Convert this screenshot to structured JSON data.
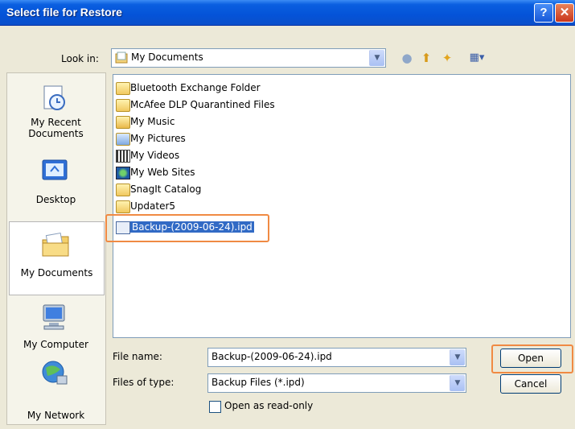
{
  "window": {
    "title": "Select file for Restore"
  },
  "toolbar": {
    "look_in_label": "Look in:",
    "look_in_value": "My Documents",
    "icons": [
      "back-icon",
      "up-folder-icon",
      "new-folder-icon",
      "views-menu-icon"
    ]
  },
  "places": [
    {
      "label": "My Recent Documents",
      "icon": "recent-documents-icon"
    },
    {
      "label": "Desktop",
      "icon": "desktop-icon"
    },
    {
      "label": "My Documents",
      "icon": "my-documents-icon",
      "selected": true
    },
    {
      "label": "My Computer",
      "icon": "my-computer-icon"
    },
    {
      "label": "My Network",
      "icon": "my-network-icon"
    }
  ],
  "files": [
    {
      "name": "Bluetooth Exchange Folder",
      "icon": "folder-icon"
    },
    {
      "name": "McAfee DLP Quarantined Files",
      "icon": "folder-icon"
    },
    {
      "name": "My Music",
      "icon": "music-folder-icon"
    },
    {
      "name": "My Pictures",
      "icon": "pictures-folder-icon"
    },
    {
      "name": "My Videos",
      "icon": "videos-folder-icon"
    },
    {
      "name": "My Web Sites",
      "icon": "websites-folder-icon"
    },
    {
      "name": "SnagIt Catalog",
      "icon": "folder-icon"
    },
    {
      "name": "Updater5",
      "icon": "folder-icon"
    },
    {
      "name": "Backup-(2009-06-24).ipd",
      "icon": "ipd-file-icon",
      "selected": true
    }
  ],
  "form": {
    "file_name_label": "File name:",
    "file_name_value": "Backup-(2009-06-24).ipd",
    "file_type_label": "Files of type:",
    "file_type_value": "Backup Files (*.ipd)",
    "read_only_label": "Open as read-only",
    "read_only_checked": false
  },
  "buttons": {
    "open": "Open",
    "cancel": "Cancel"
  },
  "colors": {
    "title_bar": "#0a5fe0",
    "highlight_outline": "#f08a43",
    "selection": "#316ac5"
  }
}
